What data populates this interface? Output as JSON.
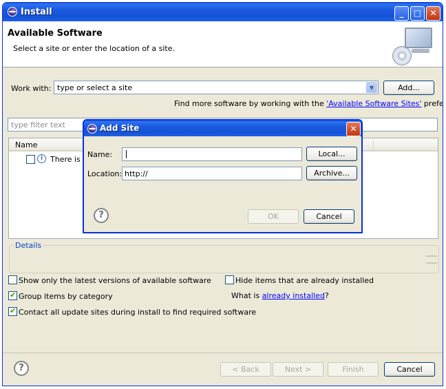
{
  "window": {
    "title": "Install",
    "buttons": {
      "minimize": "_",
      "maximize": "□",
      "close": "✕"
    }
  },
  "header": {
    "title": "Available Software",
    "description": "Select a site or enter the location of a site."
  },
  "work_with": {
    "label": "Work with:",
    "value": "type or select a site",
    "add_button": "Add...",
    "more_prefix": "Find more software by working with the ",
    "more_link": "'Available Software Sites'",
    "more_suffix": " preferences."
  },
  "filter": {
    "placeholder": "type filter text"
  },
  "tree": {
    "columns": [
      "Name"
    ],
    "rows": [
      {
        "text": "There is n"
      }
    ]
  },
  "details": {
    "legend": "Details"
  },
  "options": {
    "show_latest": {
      "label": "Show only the latest versions of available software",
      "checked": false
    },
    "hide_installed": {
      "label": "Hide items that are already installed",
      "checked": false
    },
    "group_by_category": {
      "label": "Group items by category",
      "checked": true
    },
    "what_is_prefix": "What is ",
    "what_is_link": "already installed",
    "what_is_suffix": "?",
    "contact_sites": {
      "label": "Contact all update sites during install to find required software",
      "checked": true
    }
  },
  "footer": {
    "back": "< Back",
    "next": "Next >",
    "finish": "Finish",
    "cancel": "Cancel",
    "help_symbol": "?"
  },
  "add_site_dialog": {
    "title": "Add Site",
    "close": "✕",
    "name_label": "Name:",
    "name_value": "",
    "local_button": "Local...",
    "location_label": "Location:",
    "location_value": "http://",
    "archive_button": "Archive...",
    "ok_button": "OK",
    "cancel_button": "Cancel",
    "help_symbol": "?"
  },
  "colors": {
    "titlebar": "#1a58de",
    "dialog_bg": "#ece9d8",
    "link": "#0000ff",
    "group_legend": "#0046d5"
  }
}
